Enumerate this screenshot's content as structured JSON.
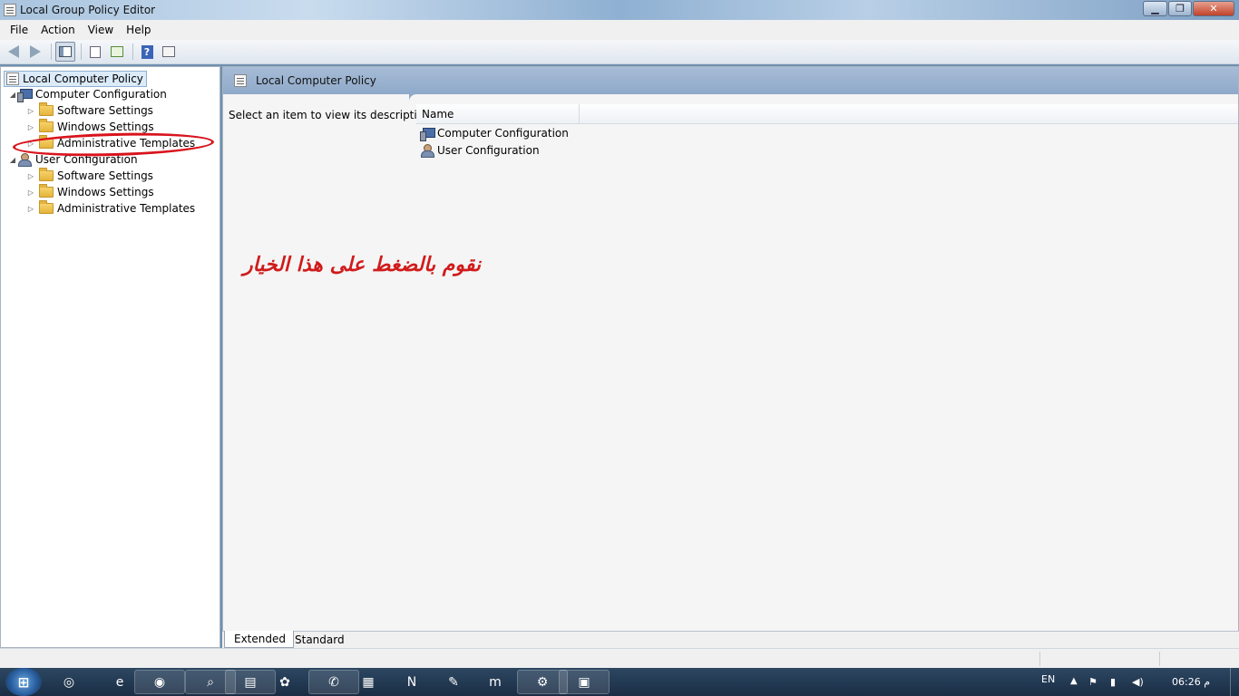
{
  "window": {
    "title": "Local Group Policy Editor",
    "controls": {
      "minimize": "▁",
      "maximize": "❐",
      "close": "✕"
    }
  },
  "menu": [
    "File",
    "Action",
    "View",
    "Help"
  ],
  "toolbar": {
    "help_glyph": "?",
    "icons": [
      "back-arrow-icon",
      "forward-arrow-icon",
      "show-hide-tree-icon",
      "list-view-icon",
      "export-list-icon",
      "help-icon",
      "properties-icon"
    ]
  },
  "tree": {
    "root": "Local Computer Policy",
    "computer_config": {
      "label": "Computer Configuration",
      "children": [
        "Software Settings",
        "Windows Settings",
        "Administrative Templates"
      ]
    },
    "user_config": {
      "label": "User Configuration",
      "children": [
        "Software Settings",
        "Windows Settings",
        "Administrative Templates"
      ]
    }
  },
  "right_pane": {
    "header": "Local Computer Policy",
    "description": "Select an item to view its description.",
    "column_name": "Name",
    "items": [
      "Computer Configuration",
      "User Configuration"
    ]
  },
  "annotation": {
    "text": "نقوم بالضغط على هذا الخيار",
    "color": "#d01b1b"
  },
  "view_tabs": [
    "Extended",
    "Standard"
  ],
  "taskbar": {
    "language": "EN",
    "time": "06:26 م"
  }
}
